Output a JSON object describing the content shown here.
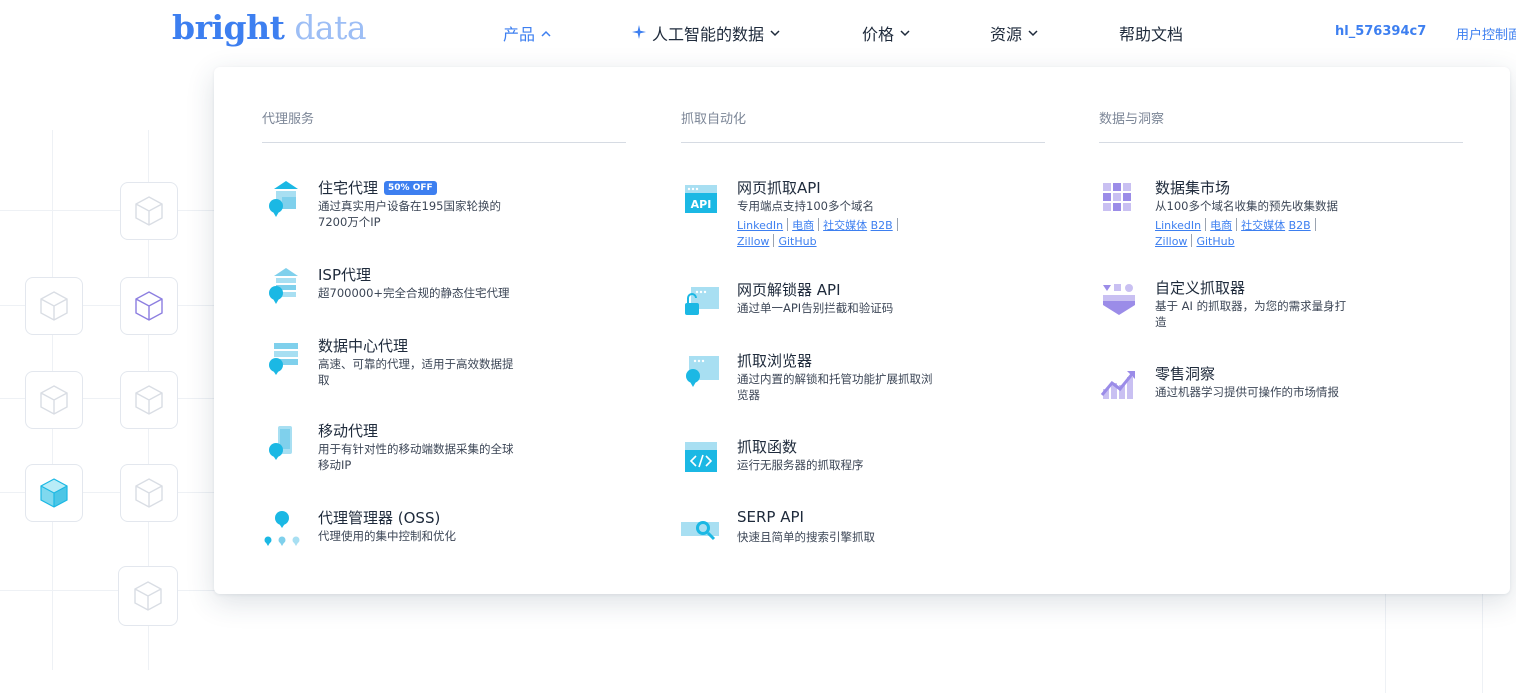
{
  "header": {
    "logo_part1": "bright",
    "logo_part2": "data",
    "nav": [
      {
        "label": "产品",
        "chevron": "up"
      },
      {
        "label": "人工智能的数据",
        "chevron": "down",
        "icon": "sparkle-icon"
      },
      {
        "label": "价格",
        "chevron": "down"
      },
      {
        "label": "资源",
        "chevron": "down"
      },
      {
        "label": "帮助文档"
      }
    ],
    "user": "hl_576394c7",
    "console": "用户控制面"
  },
  "menu": {
    "columns": [
      {
        "heading": "代理服务",
        "items": [
          {
            "title": "住宅代理",
            "badge": "50% OFF",
            "desc": "通过真实用户设备在195国家轮换的7200万个IP"
          },
          {
            "title": "ISP代理",
            "desc": "超700000+完全合规的静态住宅代理"
          },
          {
            "title": "数据中心代理",
            "desc": "高速、可靠的代理，适用于高效数据提取"
          },
          {
            "title": "移动代理",
            "desc": "用于有针对性的移动端数据采集的全球移动IP"
          },
          {
            "title": "代理管理器 (OSS)",
            "desc": "代理使用的集中控制和优化"
          }
        ]
      },
      {
        "heading": "抓取自动化",
        "items": [
          {
            "title": "网页抓取API",
            "desc": "专用端点支持100多个域名",
            "links": [
              "LinkedIn",
              "电商",
              "社交媒体",
              "B2B",
              "Zillow",
              "GitHub"
            ]
          },
          {
            "title": "网页解锁器 API",
            "desc": "通过单一API告别拦截和验证码"
          },
          {
            "title": "抓取浏览器",
            "desc": "通过内置的解锁和托管功能扩展抓取浏览器"
          },
          {
            "title": "抓取函数",
            "desc": "运行无服务器的抓取程序"
          },
          {
            "title": "SERP API",
            "desc": "快速且简单的搜索引擎抓取"
          }
        ]
      },
      {
        "heading": "数据与洞察",
        "items": [
          {
            "title": "数据集市场",
            "desc": "从100多个域名收集的预先收集数据",
            "links": [
              "LinkedIn",
              "电商",
              "社交媒体",
              "B2B",
              "Zillow",
              "GitHub"
            ]
          },
          {
            "title": "自定义抓取器",
            "desc": "基于 AI 的抓取器，为您的需求量身打造"
          },
          {
            "title": "零售洞察",
            "desc": "通过机器学习提供可操作的市场情报"
          }
        ]
      }
    ]
  },
  "colors": {
    "brand_blue": "#3d7ff0",
    "icon_cyan": "#1bb8e4",
    "icon_light_cyan": "#a8dff2",
    "icon_purple": "#9b8ce8"
  }
}
